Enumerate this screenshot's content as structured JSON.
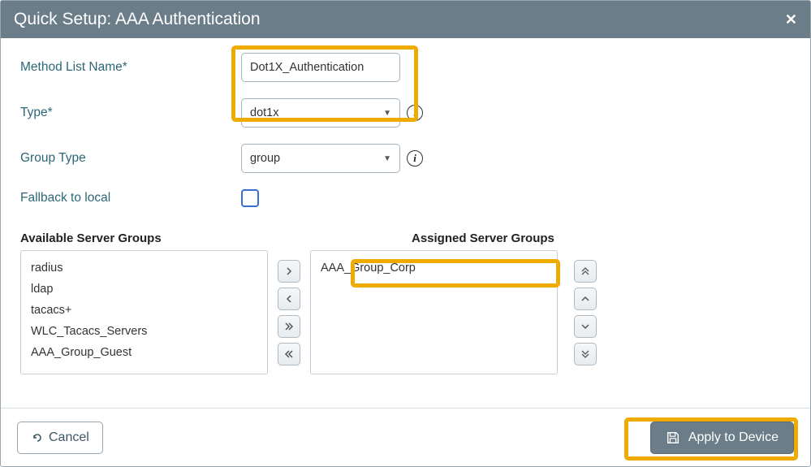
{
  "title": "Quick Setup: AAA Authentication",
  "form": {
    "method_list_name": {
      "label": "Method List Name*",
      "value": "Dot1X_Authentication"
    },
    "type": {
      "label": "Type*",
      "value": "dot1x"
    },
    "group_type": {
      "label": "Group Type",
      "value": "group"
    },
    "fallback": {
      "label": "Fallback to local",
      "checked": false
    }
  },
  "lists": {
    "available_header": "Available Server Groups",
    "assigned_header": "Assigned Server Groups",
    "available": [
      "radius",
      "ldap",
      "tacacs+",
      "WLC_Tacacs_Servers",
      "AAA_Group_Guest"
    ],
    "assigned": [
      "AAA_Group_Corp"
    ]
  },
  "buttons": {
    "cancel": "Cancel",
    "apply": "Apply to Device"
  }
}
